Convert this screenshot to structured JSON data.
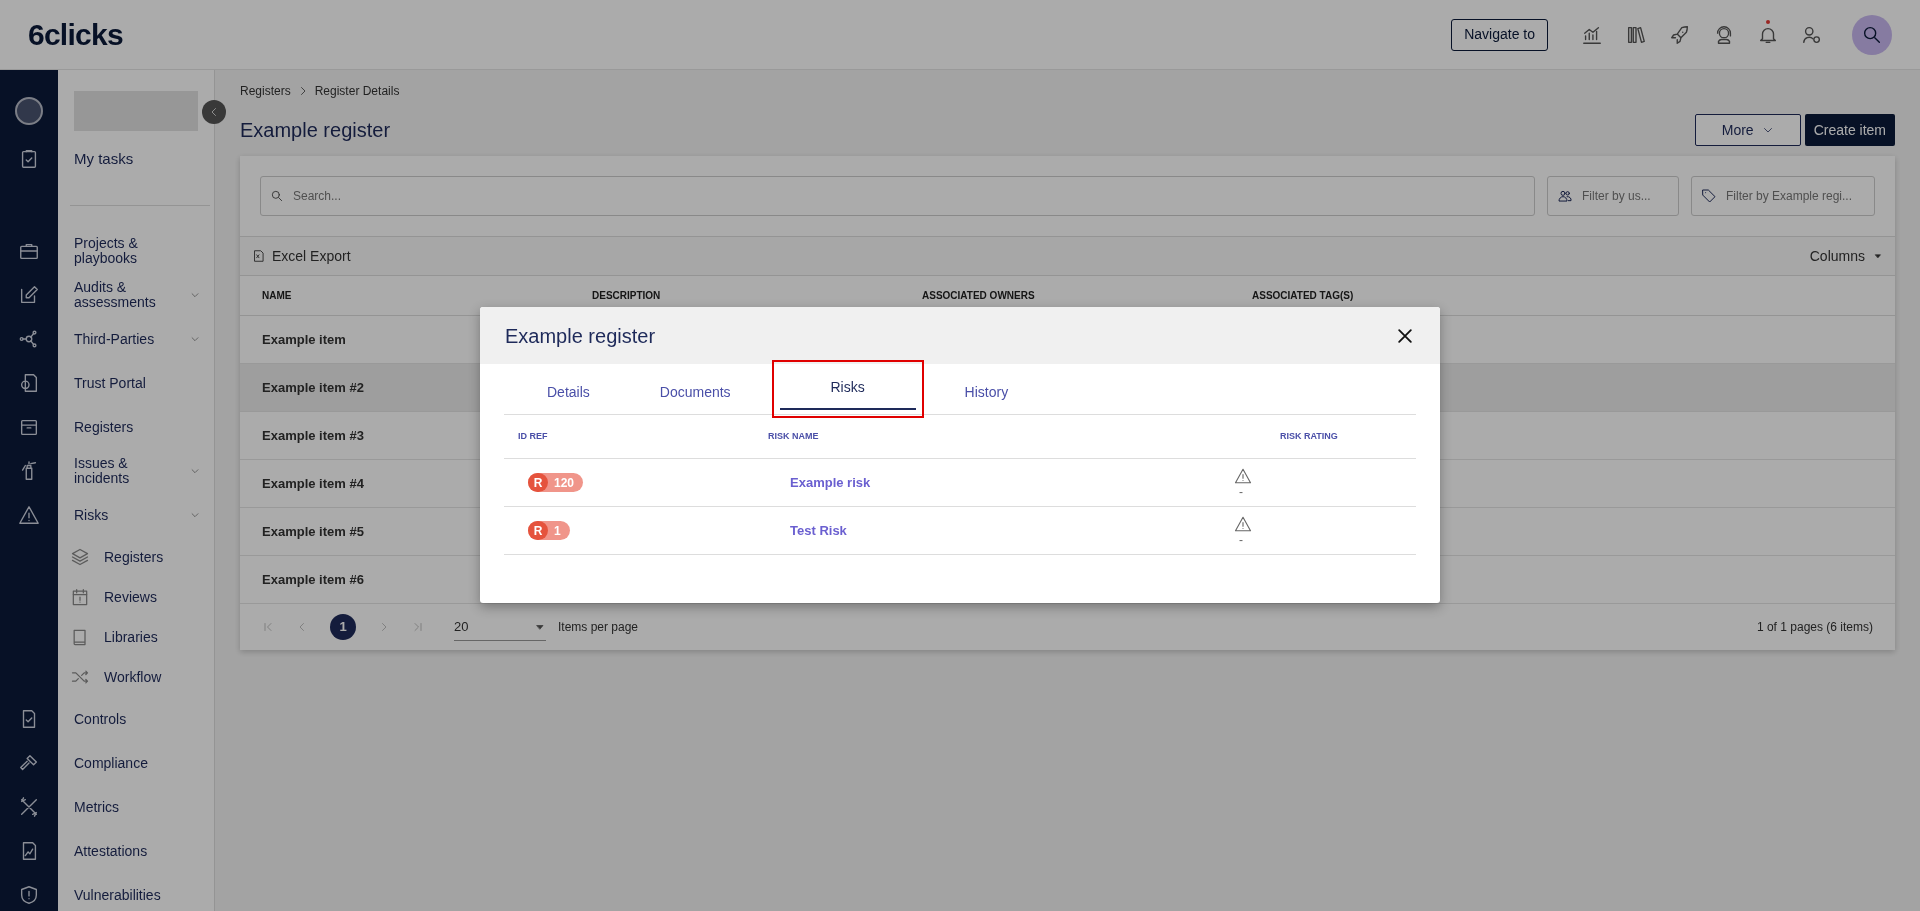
{
  "header": {
    "logo": "6clicks",
    "navigate_button": "Navigate to"
  },
  "sidebar": {
    "items": [
      {
        "label": "My tasks",
        "kind": "top"
      },
      {
        "label": "Projects & playbooks",
        "kind": "link"
      },
      {
        "label": "Audits & assessments",
        "kind": "group"
      },
      {
        "label": "Third-Parties",
        "kind": "group"
      },
      {
        "label": "Trust Portal",
        "kind": "link"
      },
      {
        "label": "Registers",
        "kind": "link"
      },
      {
        "label": "Issues & incidents",
        "kind": "group"
      },
      {
        "label": "Risks",
        "kind": "group"
      },
      {
        "label": "Registers",
        "kind": "subitem"
      },
      {
        "label": "Reviews",
        "kind": "subitem"
      },
      {
        "label": "Libraries",
        "kind": "subitem"
      },
      {
        "label": "Workflow",
        "kind": "subitem"
      },
      {
        "label": "Controls",
        "kind": "link"
      },
      {
        "label": "Compliance",
        "kind": "link"
      },
      {
        "label": "Metrics",
        "kind": "link"
      },
      {
        "label": "Attestations",
        "kind": "link"
      },
      {
        "label": "Vulnerabilities",
        "kind": "link"
      }
    ]
  },
  "breadcrumb": [
    "Registers",
    "Register Details"
  ],
  "page_title": "Example register",
  "buttons": {
    "more": "More",
    "create": "Create item"
  },
  "search": {
    "placeholder": "Search..."
  },
  "filters": [
    {
      "placeholder": "Filter by us..."
    },
    {
      "placeholder": "Filter by Example regi..."
    }
  ],
  "toolbar": {
    "export": "Excel Export",
    "columns": "Columns"
  },
  "table": {
    "columns": [
      "NAME",
      "DESCRIPTION",
      "ASSOCIATED OWNERS",
      "ASSOCIATED TAG(S)"
    ],
    "rows": [
      {
        "name": "Example item",
        "selected": false
      },
      {
        "name": "Example item #2",
        "selected": true
      },
      {
        "name": "Example item #3",
        "selected": false
      },
      {
        "name": "Example item #4",
        "selected": false
      },
      {
        "name": "Example item #5",
        "selected": false
      },
      {
        "name": "Example item #6",
        "selected": false
      }
    ]
  },
  "pagination": {
    "page": "1",
    "per_page": "20",
    "per_page_label": "Items per page",
    "summary": "1 of 1 pages (6 items)"
  },
  "modal": {
    "title": "Example register",
    "tabs": [
      {
        "label": "Details",
        "selected": false
      },
      {
        "label": "Documents",
        "selected": false
      },
      {
        "label": "Risks",
        "selected": true
      },
      {
        "label": "History",
        "selected": false
      }
    ],
    "columns": [
      "ID REF",
      "RISK NAME",
      "RISK RATING"
    ],
    "rows": [
      {
        "prefix": "R",
        "id": "120",
        "name": "Example risk",
        "rating": "-"
      },
      {
        "prefix": "R",
        "id": "1",
        "name": "Test Risk",
        "rating": "-"
      }
    ]
  }
}
